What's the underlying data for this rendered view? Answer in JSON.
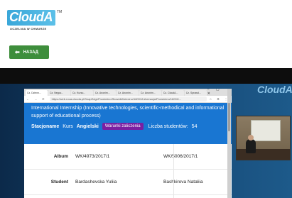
{
  "logo": {
    "brand": "CloudA",
    "tm": "TM",
    "subtitle": "UCZELNIA W CHMURZE"
  },
  "back_button": {
    "label": "НАЗАД",
    "icon": "arrow-left-icon"
  },
  "watermark": {
    "brand": "CloudA"
  },
  "browser": {
    "tabs": [
      "Cz. Dzienn...",
      "Cz. Negoc...",
      "Cz. Kurso...",
      "Cz. Anonim...",
      "Cz. Anonim...",
      "Cz. Anonim...",
      "Cz. CloudA...",
      "Cz. Sprawd..."
    ],
    "url": "https://web.roua.clouda.pl/SnapEdgeProwimino/SlownikDziecinu/16091/Informacja/Prowimino/16091/..."
  },
  "course": {
    "title": "International Internship (Innovative technologies, scientific-methodical and informational support of educational process)",
    "mode": "Stacjoname",
    "type": "Kurs",
    "language": "Angielski",
    "badge": "Warunki zaliczenia",
    "students_label": "Liczba studentów:",
    "students_count": "54"
  },
  "table": {
    "rows": [
      {
        "label": "Album",
        "values": [
          "WK/4973/2017/1",
          "WK/5006/2017/1"
        ]
      },
      {
        "label": "Student",
        "values": [
          "Bardashevska Yuliia",
          "Bashkirova Nataliia"
        ]
      }
    ]
  },
  "colors": {
    "accent_green": "#3e8e3c",
    "course_blue": "#1976d2",
    "badge_purple": "#7b1fa2"
  }
}
